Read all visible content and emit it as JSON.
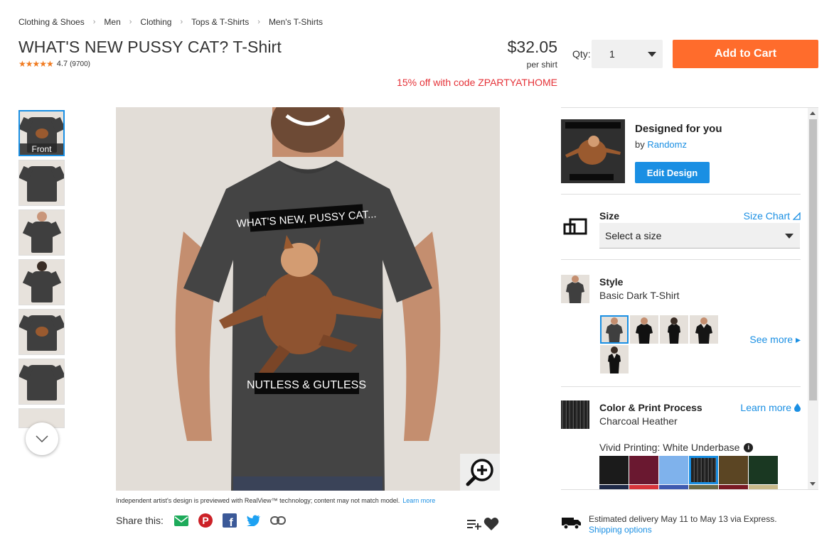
{
  "breadcrumb": [
    "Clothing & Shoes",
    "Men",
    "Clothing",
    "Tops & T-Shirts",
    "Men's T-Shirts"
  ],
  "product": {
    "title": "WHAT'S NEW PUSSY CAT? T-Shirt",
    "rating_stars": "★★★★★",
    "rating_value": "4.7",
    "rating_count": "(9700)",
    "price": "$32.05",
    "per": "per shirt",
    "promo": "15% off with code ZPARTYATHOME",
    "shirt_text_top": "WHAT'S NEW, PUSSY CAT...",
    "shirt_text_bottom": "NUTLESS & GUTLESS"
  },
  "purchase": {
    "qty_label": "Qty:",
    "qty_value": "1",
    "add_to_cart": "Add to Cart"
  },
  "thumbnails": {
    "front_label": "Front"
  },
  "image": {
    "disclaimer": "Independent artist's design is previewed with RealView™ technology; content may not match model.",
    "learn_more": "Learn more",
    "share_label": "Share this:"
  },
  "designed": {
    "heading": "Designed for you",
    "by": "by ",
    "designer": "Randomz",
    "edit_button": "Edit Design"
  },
  "size": {
    "heading": "Size",
    "chart_link": "Size Chart",
    "placeholder": "Select a size"
  },
  "style": {
    "heading": "Style",
    "value": "Basic Dark T-Shirt",
    "see_more": "See more ▸"
  },
  "color": {
    "heading": "Color & Print Process",
    "value": "Charcoal Heather",
    "learn_more": "Learn more",
    "vivid": "Vivid Printing: White Underbase",
    "info": "i",
    "swatches": [
      "#1b1b1b",
      "#6a1830",
      "#7fb2ec",
      "#2a2a2a",
      "#5b4523",
      "#1a3822",
      "#1f2a48",
      "#d8343a",
      "#3f5ab0",
      "#6b6a48",
      "#7a1a24",
      "#c9b98a"
    ]
  },
  "delivery": {
    "text": "Estimated delivery May 11 to May 13 via Express.",
    "link": "Shipping options"
  }
}
